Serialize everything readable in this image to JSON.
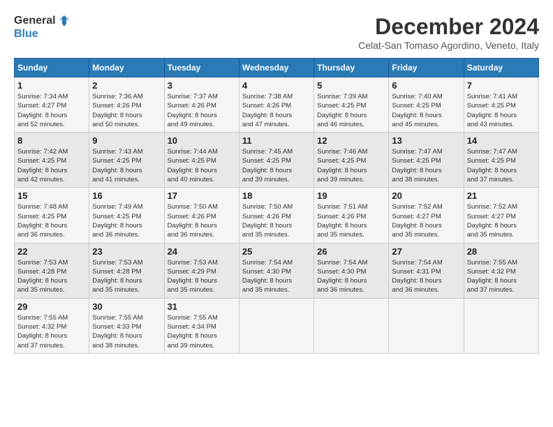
{
  "logo": {
    "line1": "General",
    "line2": "Blue"
  },
  "title": "December 2024",
  "subtitle": "Celat-San Tomaso Agordino, Veneto, Italy",
  "days_of_week": [
    "Sunday",
    "Monday",
    "Tuesday",
    "Wednesday",
    "Thursday",
    "Friday",
    "Saturday"
  ],
  "weeks": [
    [
      {
        "num": "1",
        "info": "Sunrise: 7:34 AM\nSunset: 4:27 PM\nDaylight: 8 hours\nand 52 minutes."
      },
      {
        "num": "2",
        "info": "Sunrise: 7:36 AM\nSunset: 4:26 PM\nDaylight: 8 hours\nand 50 minutes."
      },
      {
        "num": "3",
        "info": "Sunrise: 7:37 AM\nSunset: 4:26 PM\nDaylight: 8 hours\nand 49 minutes."
      },
      {
        "num": "4",
        "info": "Sunrise: 7:38 AM\nSunset: 4:26 PM\nDaylight: 8 hours\nand 47 minutes."
      },
      {
        "num": "5",
        "info": "Sunrise: 7:39 AM\nSunset: 4:25 PM\nDaylight: 8 hours\nand 46 minutes."
      },
      {
        "num": "6",
        "info": "Sunrise: 7:40 AM\nSunset: 4:25 PM\nDaylight: 8 hours\nand 45 minutes."
      },
      {
        "num": "7",
        "info": "Sunrise: 7:41 AM\nSunset: 4:25 PM\nDaylight: 8 hours\nand 43 minutes."
      }
    ],
    [
      {
        "num": "8",
        "info": "Sunrise: 7:42 AM\nSunset: 4:25 PM\nDaylight: 8 hours\nand 42 minutes."
      },
      {
        "num": "9",
        "info": "Sunrise: 7:43 AM\nSunset: 4:25 PM\nDaylight: 8 hours\nand 41 minutes."
      },
      {
        "num": "10",
        "info": "Sunrise: 7:44 AM\nSunset: 4:25 PM\nDaylight: 8 hours\nand 40 minutes."
      },
      {
        "num": "11",
        "info": "Sunrise: 7:45 AM\nSunset: 4:25 PM\nDaylight: 8 hours\nand 39 minutes."
      },
      {
        "num": "12",
        "info": "Sunrise: 7:46 AM\nSunset: 4:25 PM\nDaylight: 8 hours\nand 39 minutes."
      },
      {
        "num": "13",
        "info": "Sunrise: 7:47 AM\nSunset: 4:25 PM\nDaylight: 8 hours\nand 38 minutes."
      },
      {
        "num": "14",
        "info": "Sunrise: 7:47 AM\nSunset: 4:25 PM\nDaylight: 8 hours\nand 37 minutes."
      }
    ],
    [
      {
        "num": "15",
        "info": "Sunrise: 7:48 AM\nSunset: 4:25 PM\nDaylight: 8 hours\nand 36 minutes."
      },
      {
        "num": "16",
        "info": "Sunrise: 7:49 AM\nSunset: 4:25 PM\nDaylight: 8 hours\nand 36 minutes."
      },
      {
        "num": "17",
        "info": "Sunrise: 7:50 AM\nSunset: 4:26 PM\nDaylight: 8 hours\nand 36 minutes."
      },
      {
        "num": "18",
        "info": "Sunrise: 7:50 AM\nSunset: 4:26 PM\nDaylight: 8 hours\nand 35 minutes."
      },
      {
        "num": "19",
        "info": "Sunrise: 7:51 AM\nSunset: 4:26 PM\nDaylight: 8 hours\nand 35 minutes."
      },
      {
        "num": "20",
        "info": "Sunrise: 7:52 AM\nSunset: 4:27 PM\nDaylight: 8 hours\nand 35 minutes."
      },
      {
        "num": "21",
        "info": "Sunrise: 7:52 AM\nSunset: 4:27 PM\nDaylight: 8 hours\nand 35 minutes."
      }
    ],
    [
      {
        "num": "22",
        "info": "Sunrise: 7:53 AM\nSunset: 4:28 PM\nDaylight: 8 hours\nand 35 minutes."
      },
      {
        "num": "23",
        "info": "Sunrise: 7:53 AM\nSunset: 4:28 PM\nDaylight: 8 hours\nand 35 minutes."
      },
      {
        "num": "24",
        "info": "Sunrise: 7:53 AM\nSunset: 4:29 PM\nDaylight: 8 hours\nand 35 minutes."
      },
      {
        "num": "25",
        "info": "Sunrise: 7:54 AM\nSunset: 4:30 PM\nDaylight: 8 hours\nand 35 minutes."
      },
      {
        "num": "26",
        "info": "Sunrise: 7:54 AM\nSunset: 4:30 PM\nDaylight: 8 hours\nand 36 minutes."
      },
      {
        "num": "27",
        "info": "Sunrise: 7:54 AM\nSunset: 4:31 PM\nDaylight: 8 hours\nand 36 minutes."
      },
      {
        "num": "28",
        "info": "Sunrise: 7:55 AM\nSunset: 4:32 PM\nDaylight: 8 hours\nand 37 minutes."
      }
    ],
    [
      {
        "num": "29",
        "info": "Sunrise: 7:55 AM\nSunset: 4:32 PM\nDaylight: 8 hours\nand 37 minutes."
      },
      {
        "num": "30",
        "info": "Sunrise: 7:55 AM\nSunset: 4:33 PM\nDaylight: 8 hours\nand 38 minutes."
      },
      {
        "num": "31",
        "info": "Sunrise: 7:55 AM\nSunset: 4:34 PM\nDaylight: 8 hours\nand 39 minutes."
      },
      null,
      null,
      null,
      null
    ]
  ]
}
